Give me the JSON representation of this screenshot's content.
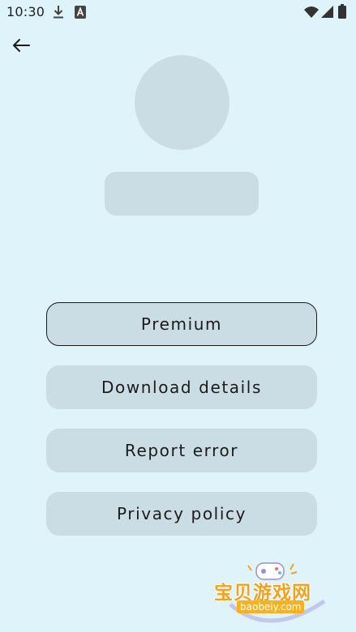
{
  "status_bar": {
    "time": "10:30",
    "icons": [
      "download-icon",
      "a-letter-icon",
      "wifi-icon",
      "signal-icon",
      "battery-icon"
    ]
  },
  "header": {
    "back_icon": "arrow-left-icon"
  },
  "menu": {
    "items": [
      {
        "label": "Premium",
        "selected": true
      },
      {
        "label": "Download details",
        "selected": false
      },
      {
        "label": "Report error",
        "selected": false
      },
      {
        "label": "Privacy policy",
        "selected": false
      }
    ]
  },
  "watermark": {
    "title": "宝贝游戏网",
    "url": "baobeiy.com"
  },
  "colors": {
    "background": "#dff3fb",
    "placeholder": "#cbdde4",
    "text": "#1b1b1b",
    "watermark": "#f4a21c"
  }
}
